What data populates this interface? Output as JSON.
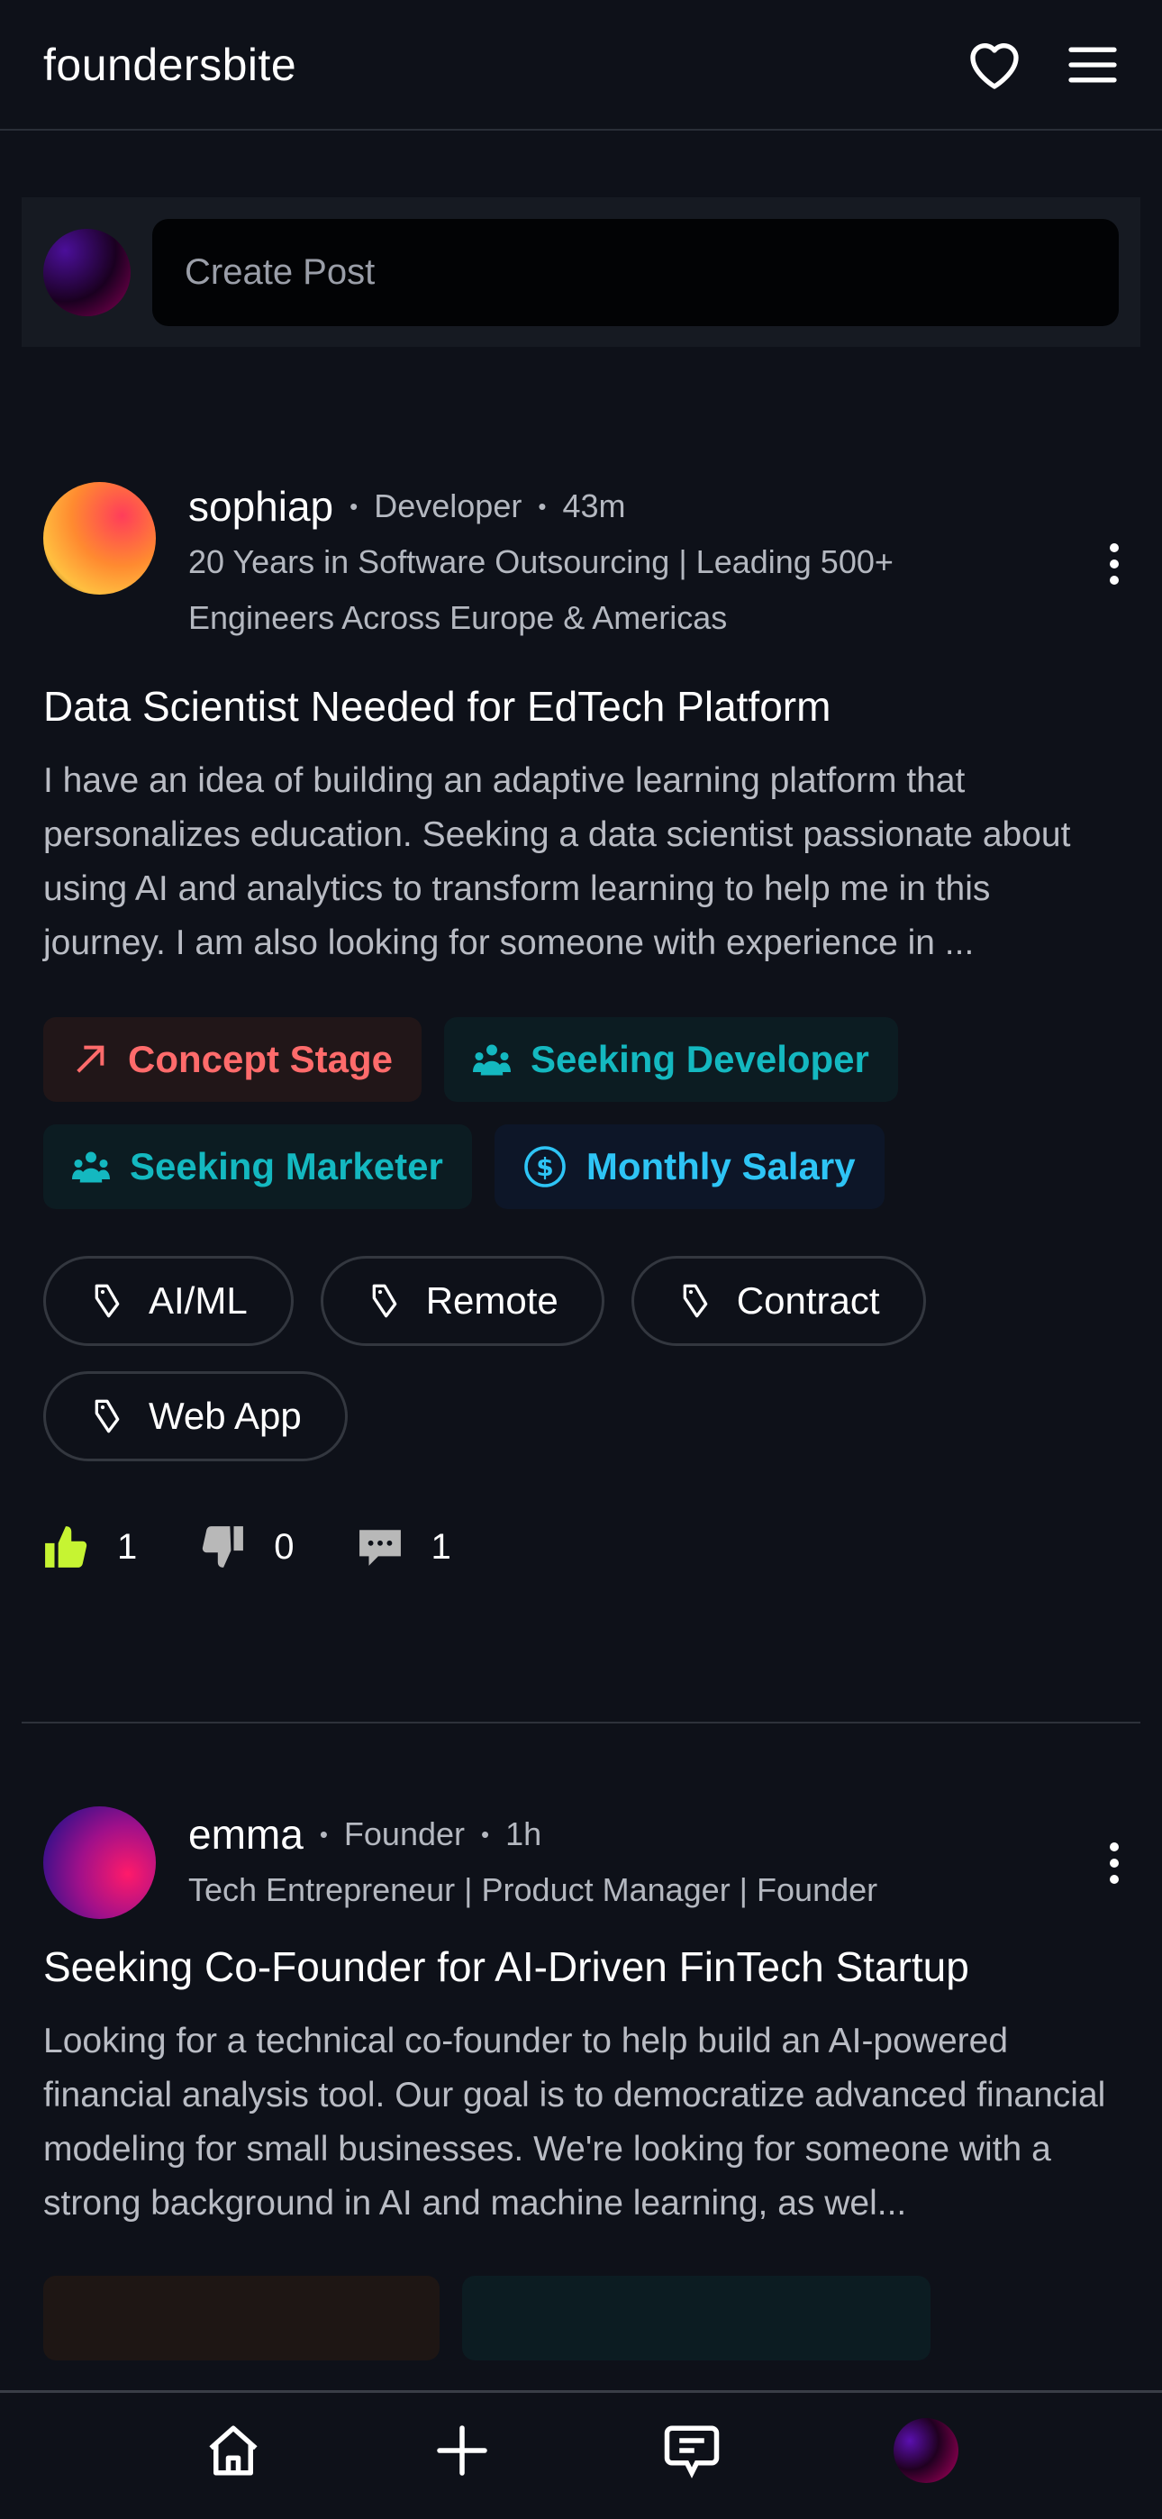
{
  "header": {
    "title": "foundersbite",
    "icons": [
      "heart-icon",
      "menu-icon"
    ]
  },
  "create_post": {
    "placeholder": "Create Post"
  },
  "posts": [
    {
      "username": "sophiap",
      "role": "Developer",
      "time": "43m",
      "bio": "20 Years in Software Outsourcing | Leading 500+ Engineers Across Europe & Americas",
      "title": "Data Scientist Needed for EdTech Platform",
      "body": "I have an idea of building an adaptive learning platform that personalizes education. Seeking a data scientist passionate about using AI and analytics to transform learning to help me in this journey. I am also looking for someone with experience in ...",
      "badges": [
        {
          "label": "Concept Stage",
          "icon": "arrow-up-right-icon",
          "color": "#ff6b6b"
        },
        {
          "label": "Seeking Developer",
          "icon": "users-icon",
          "color": "#14b8c0"
        },
        {
          "label": "Seeking Marketer",
          "icon": "users-icon",
          "color": "#14b8c0"
        },
        {
          "label": "Monthly Salary",
          "icon": "dollar-circle-icon",
          "color": "#2ec4f5"
        }
      ],
      "tags": [
        "AI/ML",
        "Remote",
        "Contract",
        "Web App"
      ],
      "likes": "1",
      "dislikes": "0",
      "comments": "1"
    },
    {
      "username": "emma",
      "role": "Founder",
      "time": "1h",
      "bio": "Tech Entrepreneur | Product Manager | Founder",
      "title": "Seeking Co-Founder for AI-Driven FinTech Startup",
      "body": "Looking for a technical co-founder to help build an AI-powered financial analysis tool. Our goal is to democratize advanced financial modeling for small businesses. We're looking for someone with a strong background in AI and machine learning, as wel..."
    }
  ],
  "colors": {
    "background": "#0e1119",
    "like_active": "#c6f432"
  },
  "bottom_nav": [
    "home-icon",
    "plus-icon",
    "messages-icon",
    "profile-avatar"
  ]
}
